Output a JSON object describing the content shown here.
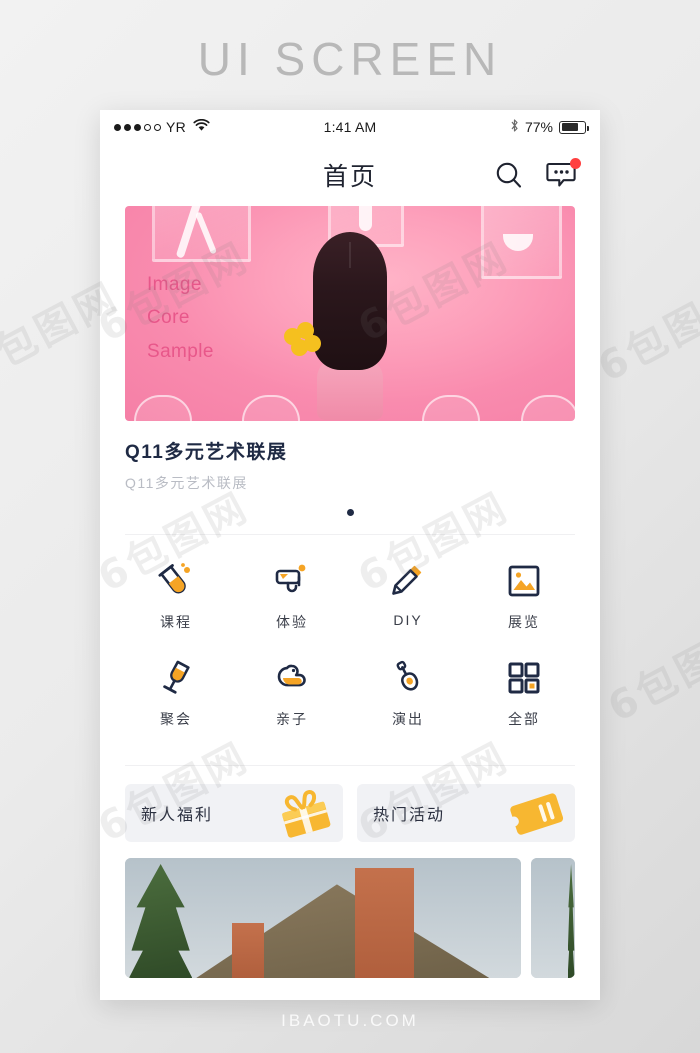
{
  "page": {
    "heading": "UI SCREEN",
    "footer_watermark": "IBAOTU.COM",
    "watermark_text": "6包图网"
  },
  "status_bar": {
    "carrier": "YR",
    "signal_filled": 3,
    "signal_total": 5,
    "wifi_icon": "wifi-icon",
    "time": "1:41 AM",
    "bluetooth_icon": "bluetooth-icon",
    "battery_percent": "77%",
    "battery_level": 77
  },
  "nav": {
    "title": "首页",
    "search_icon": "search-icon",
    "message_icon": "chat-bubble-icon",
    "has_unread_badge": true
  },
  "banner": {
    "overlay_lines": [
      "Image",
      "Core",
      "Sample"
    ],
    "title": "Q11多元艺术联展",
    "subtitle": "Q11多元艺术联展",
    "pager_dots": 1,
    "active_dot": 0
  },
  "categories": [
    {
      "label": "课程",
      "icon": "test-tube-icon"
    },
    {
      "label": "体验",
      "icon": "diving-mask-icon"
    },
    {
      "label": "DIY",
      "icon": "pencil-icon"
    },
    {
      "label": "展览",
      "icon": "picture-frame-icon"
    },
    {
      "label": "聚会",
      "icon": "champagne-glass-icon"
    },
    {
      "label": "亲子",
      "icon": "rubber-duck-icon"
    },
    {
      "label": "演出",
      "icon": "guitar-icon"
    },
    {
      "label": "全部",
      "icon": "grid-squares-icon"
    }
  ],
  "promos": [
    {
      "label": "新人福利",
      "icon": "gift-box-icon"
    },
    {
      "label": "热门活动",
      "icon": "ticket-icon"
    }
  ],
  "colors": {
    "dark_navy": "#1f2a44",
    "accent_orange": "#f5a425",
    "badge_red": "#ff4040",
    "banner_pink": "#f98bae",
    "promo_bg": "#f1f2f5"
  }
}
